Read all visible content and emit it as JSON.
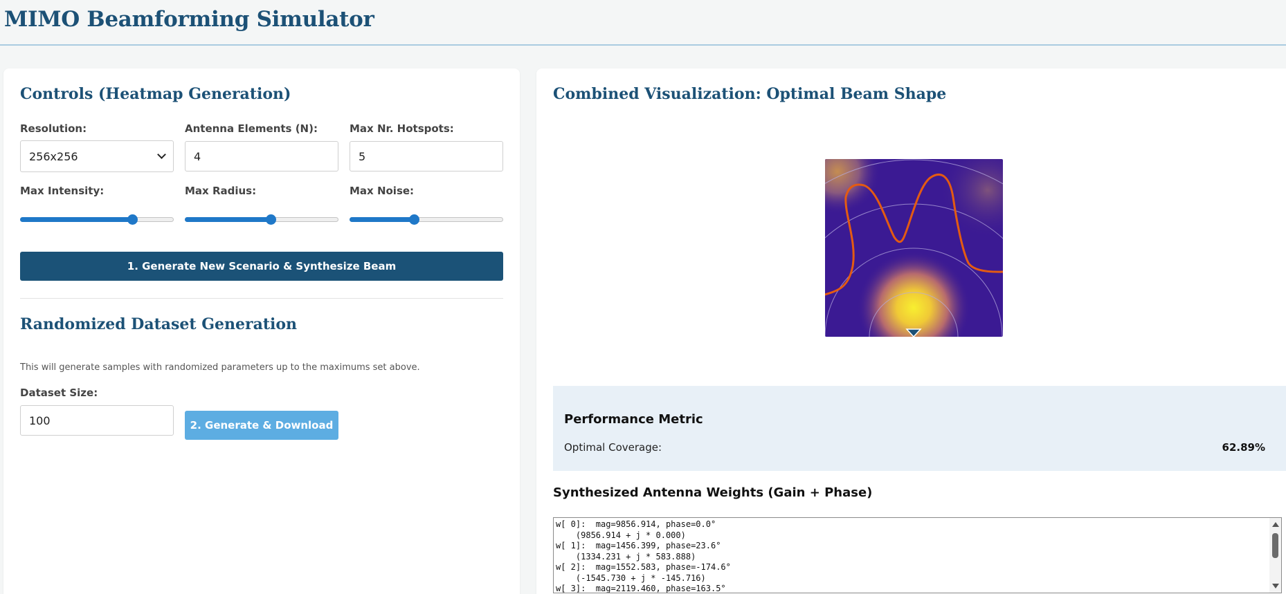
{
  "app": {
    "title": "MIMO Beamforming Simulator"
  },
  "controls": {
    "title": "Controls (Heatmap Generation)",
    "resolution": {
      "label": "Resolution:",
      "value": "256x256",
      "options": [
        "256x256"
      ]
    },
    "antenna_elements": {
      "label": "Antenna Elements (N):",
      "value": "4"
    },
    "max_hotspots": {
      "label": "Max Nr. Hotspots:",
      "value": "5"
    },
    "max_intensity": {
      "label": "Max Intensity:",
      "level": 0.73
    },
    "max_radius": {
      "label": "Max Radius:",
      "level": 0.56
    },
    "max_noise": {
      "label": "Max Noise:",
      "level": 0.42
    },
    "generate_button": "1. Generate New Scenario & Synthesize Beam"
  },
  "dataset": {
    "title": "Randomized Dataset Generation",
    "hint": "This will generate samples with randomized parameters up to the maximums set above.",
    "size_label": "Dataset Size:",
    "size_value": "100",
    "download_button": "2. Generate & Download"
  },
  "visualization": {
    "title": "Combined Visualization: Optimal Beam Shape",
    "colors": {
      "background": "#3b1a93",
      "hotspot": "#f5ea2f",
      "beam": "#e45b12",
      "rings": "#b6a9de",
      "marker": "#1c5176"
    }
  },
  "metrics": {
    "title": "Performance Metric",
    "coverage_label": "Optimal Coverage:",
    "coverage_value": "62.89%"
  },
  "weights": {
    "title": "Synthesized Antenna Weights (Gain + Phase)",
    "text": "w[ 0]:  mag=9856.914, phase=0.0°\n    (9856.914 + j * 0.000)\nw[ 1]:  mag=1456.399, phase=23.6°\n    (1334.231 + j * 583.888)\nw[ 2]:  mag=1552.583, phase=-174.6°\n    (-1545.730 + j * -145.716)\nw[ 3]:  mag=2119.460, phase=163.5°"
  }
}
